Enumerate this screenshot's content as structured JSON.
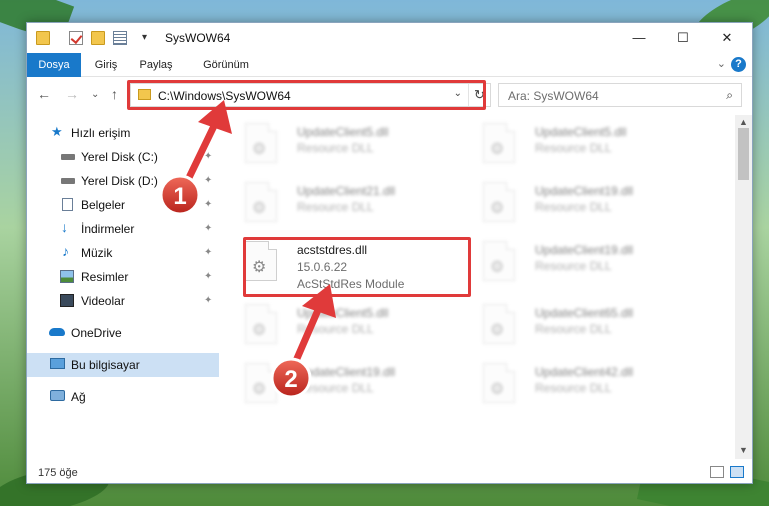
{
  "window": {
    "title": "SysWOW64",
    "controls": {
      "minimize": "—",
      "maximize": "☐",
      "close": "✕"
    }
  },
  "ribbon": {
    "tabs": [
      {
        "label": "Dosya"
      },
      {
        "label": "Giriş"
      },
      {
        "label": "Paylaş"
      },
      {
        "label": "Görünüm"
      }
    ],
    "help": "?"
  },
  "address": {
    "path": "C:\\Windows\\SysWOW64",
    "search_placeholder": "Ara: SysWOW64"
  },
  "sidebar": {
    "items": [
      {
        "label": "Hızlı erişim",
        "icon": "star-icon"
      },
      {
        "label": "Yerel Disk (C:)",
        "icon": "drive-icon"
      },
      {
        "label": "Yerel Disk (D:)",
        "icon": "drive-icon"
      },
      {
        "label": "Belgeler",
        "icon": "document-icon"
      },
      {
        "label": "İndirmeler",
        "icon": "download-icon"
      },
      {
        "label": "Müzik",
        "icon": "music-icon"
      },
      {
        "label": "Resimler",
        "icon": "picture-icon"
      },
      {
        "label": "Videolar",
        "icon": "video-icon"
      },
      {
        "label": "OneDrive",
        "icon": "cloud-icon"
      },
      {
        "label": "Bu bilgisayar",
        "icon": "computer-icon"
      },
      {
        "label": "Ağ",
        "icon": "network-icon"
      }
    ]
  },
  "files": [
    {
      "name": "UpdateClient5.dll",
      "type": "Resource DLL"
    },
    {
      "name": "UpdateClient5.dll",
      "type": "Resource DLL"
    },
    {
      "name": "UpdateClient21.dll",
      "type": "Resource DLL"
    },
    {
      "name": "UpdateClient19.dll",
      "type": "Resource DLL"
    },
    {
      "name": "acststdres.dll",
      "version": "15.0.6.22",
      "type": "AcStStdRes Module"
    },
    {
      "name": "UpdateClient19.dll",
      "type": "Resource DLL"
    },
    {
      "name": "UpdateClient5.dll",
      "type": "Resource DLL"
    },
    {
      "name": "UpdateClient65.dll",
      "type": "Resource DLL"
    },
    {
      "name": "UpdateClient19.dll",
      "type": "Resource DLL"
    },
    {
      "name": "UpdateClient42.dll",
      "type": "Resource DLL"
    }
  ],
  "status": {
    "count": "175 öğe"
  },
  "annotations": {
    "step1": "1",
    "step2": "2",
    "color": "#e03a3a"
  }
}
